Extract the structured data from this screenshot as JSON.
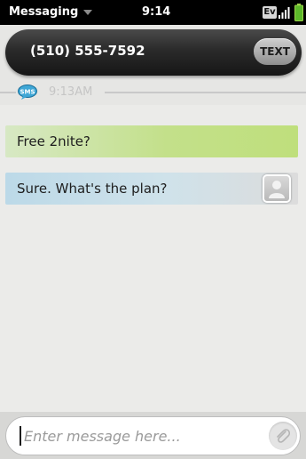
{
  "status_bar": {
    "app_name": "Messaging",
    "time": "9:14",
    "network": "Ev",
    "signal_icon": "signal-bars-icon",
    "battery_icon": "battery-icon"
  },
  "header": {
    "contact": "(510) 555-7592",
    "text_button_label": "TEXT"
  },
  "conversation": {
    "service_badge": "SMS",
    "timestamp": "9:13AM",
    "messages": [
      {
        "direction": "incoming",
        "text": "Free 2nite?"
      },
      {
        "direction": "outgoing",
        "text": "Sure. What's the plan?"
      }
    ]
  },
  "compose": {
    "placeholder": "Enter message here...",
    "attach_icon": "paperclip-icon"
  },
  "colors": {
    "incoming_bubble": "#c3e08a",
    "outgoing_bubble": "#bcd9e8",
    "header_bg": "#2a2a2a"
  }
}
